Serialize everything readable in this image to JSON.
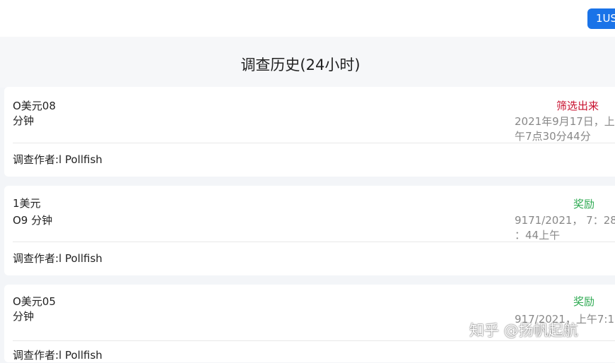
{
  "header": {
    "currency_button": "1US",
    "title": "调查历史(24小时)"
  },
  "surveys": [
    {
      "amount_line1": "O美元08",
      "amount_line2": "分钟",
      "status": "筛选出来",
      "date_line1": "2021年9月17日，上",
      "date_line2": "午7点30分44分",
      "author": "调查作者:l Pollfish"
    },
    {
      "amount_line1": "1美元",
      "amount_line2": "O9 分钟",
      "status": "奖励",
      "date_line1": "9171/2021，  7：28",
      "date_line2": "：44上午",
      "author": "调查作者:l Pollfish"
    },
    {
      "amount_line1": "O美元05",
      "amount_line2": "分钟",
      "status": "奖励",
      "date_line1": "917/2021，上午7:1",
      "author": "调查作者:l Pollfish"
    }
  ],
  "watermark": "知乎 @扬帆起航",
  "colors": {
    "accent": "#1a73e8",
    "status_screened": "#c8102e",
    "status_rewarded": "#2eaa52"
  }
}
